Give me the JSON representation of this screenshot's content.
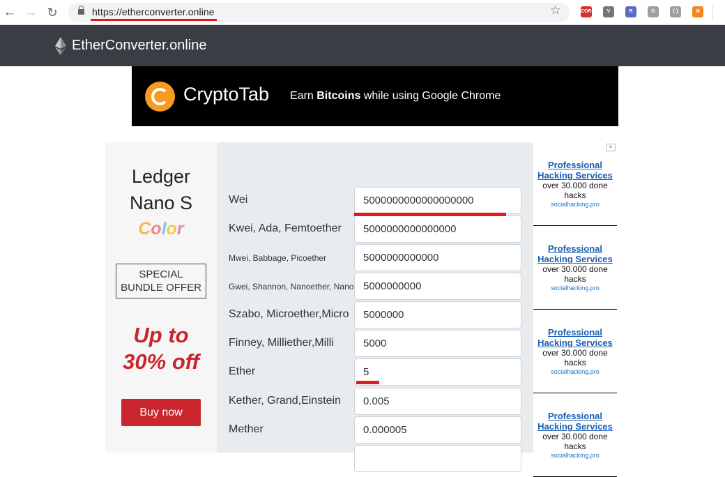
{
  "browser": {
    "url": "https://etherconverter.online",
    "extensions": [
      {
        "name": "cors-extension",
        "label": "CORS",
        "color": "#d32f2f"
      },
      {
        "name": "vue-devtools",
        "label": "V",
        "color": "#757575"
      },
      {
        "name": "r-extension",
        "label": "R",
        "color": "#5c6bc0"
      },
      {
        "name": "g-extension",
        "label": "G",
        "color": "#9e9e9e"
      },
      {
        "name": "braces-extension",
        "label": "{ }",
        "color": "#9e9e9e"
      },
      {
        "name": "metamask",
        "label": "M",
        "color": "#f6851b"
      }
    ]
  },
  "site": {
    "brand": "EtherConverter.online"
  },
  "banner": {
    "name": "CryptoTab",
    "tag_prefix": "Earn ",
    "tag_bold": "Bitcoins",
    "tag_suffix": " while using Google Chrome"
  },
  "ledger_ad": {
    "line1": "Ledger",
    "line2": "Nano S",
    "color_word": "Color",
    "color_letters": [
      "C",
      "o",
      "l",
      "o",
      "r"
    ],
    "color_palette": [
      "#f5b84a",
      "#ef8a8a",
      "#7fc7e8",
      "#f3c84f",
      "#e28aa8"
    ],
    "bundle_line1": "SPECIAL",
    "bundle_line2": "BUNDLE OFFER",
    "promo_line1": "Up to",
    "promo_line2": "30% off",
    "buy_label": "Buy now"
  },
  "converter": {
    "rows": [
      {
        "label": "Wei",
        "value": "5000000000000000000"
      },
      {
        "label": "Kwei, Ada, Femtoether",
        "value": "5000000000000000"
      },
      {
        "label": "Mwei, Babbage, Picoether",
        "value": "5000000000000"
      },
      {
        "label": "Gwei, Shannon, Nanoether, Nano",
        "value": "5000000000"
      },
      {
        "label": "Szabo, Microether,Micro",
        "value": "5000000"
      },
      {
        "label": "Finney, Milliether,Milli",
        "value": "5000"
      },
      {
        "label": "Ether",
        "value": "5"
      },
      {
        "label": "Kether, Grand,Einstein",
        "value": "0.005"
      },
      {
        "label": "Mether",
        "value": "0.000005"
      },
      {
        "label": "",
        "value": ""
      }
    ]
  },
  "side_ads": [
    {
      "title_line1": "Professional",
      "title_line2": "Hacking Services",
      "text_line1": "over 30.000 done",
      "text_line2": "hacks",
      "url": "socialhacking.pro"
    },
    {
      "title_line1": "Professional",
      "title_line2": "Hacking Services",
      "text_line1": "over 30.000 done",
      "text_line2": "hacks",
      "url": "socialhacking.pro"
    },
    {
      "title_line1": "Professional",
      "title_line2": "Hacking Services",
      "text_line1": "over 30.000 done",
      "text_line2": "hacks",
      "url": "socialhacking.pro"
    },
    {
      "title_line1": "Professional",
      "title_line2": "Hacking Services",
      "text_line1": "over 30.000 done",
      "text_line2": "hacks",
      "url": "socialhacking.pro"
    }
  ],
  "colors": {
    "header_bg": "#3a3d43",
    "accent_red": "#c8252e",
    "annotation_red": "#e0191f"
  }
}
